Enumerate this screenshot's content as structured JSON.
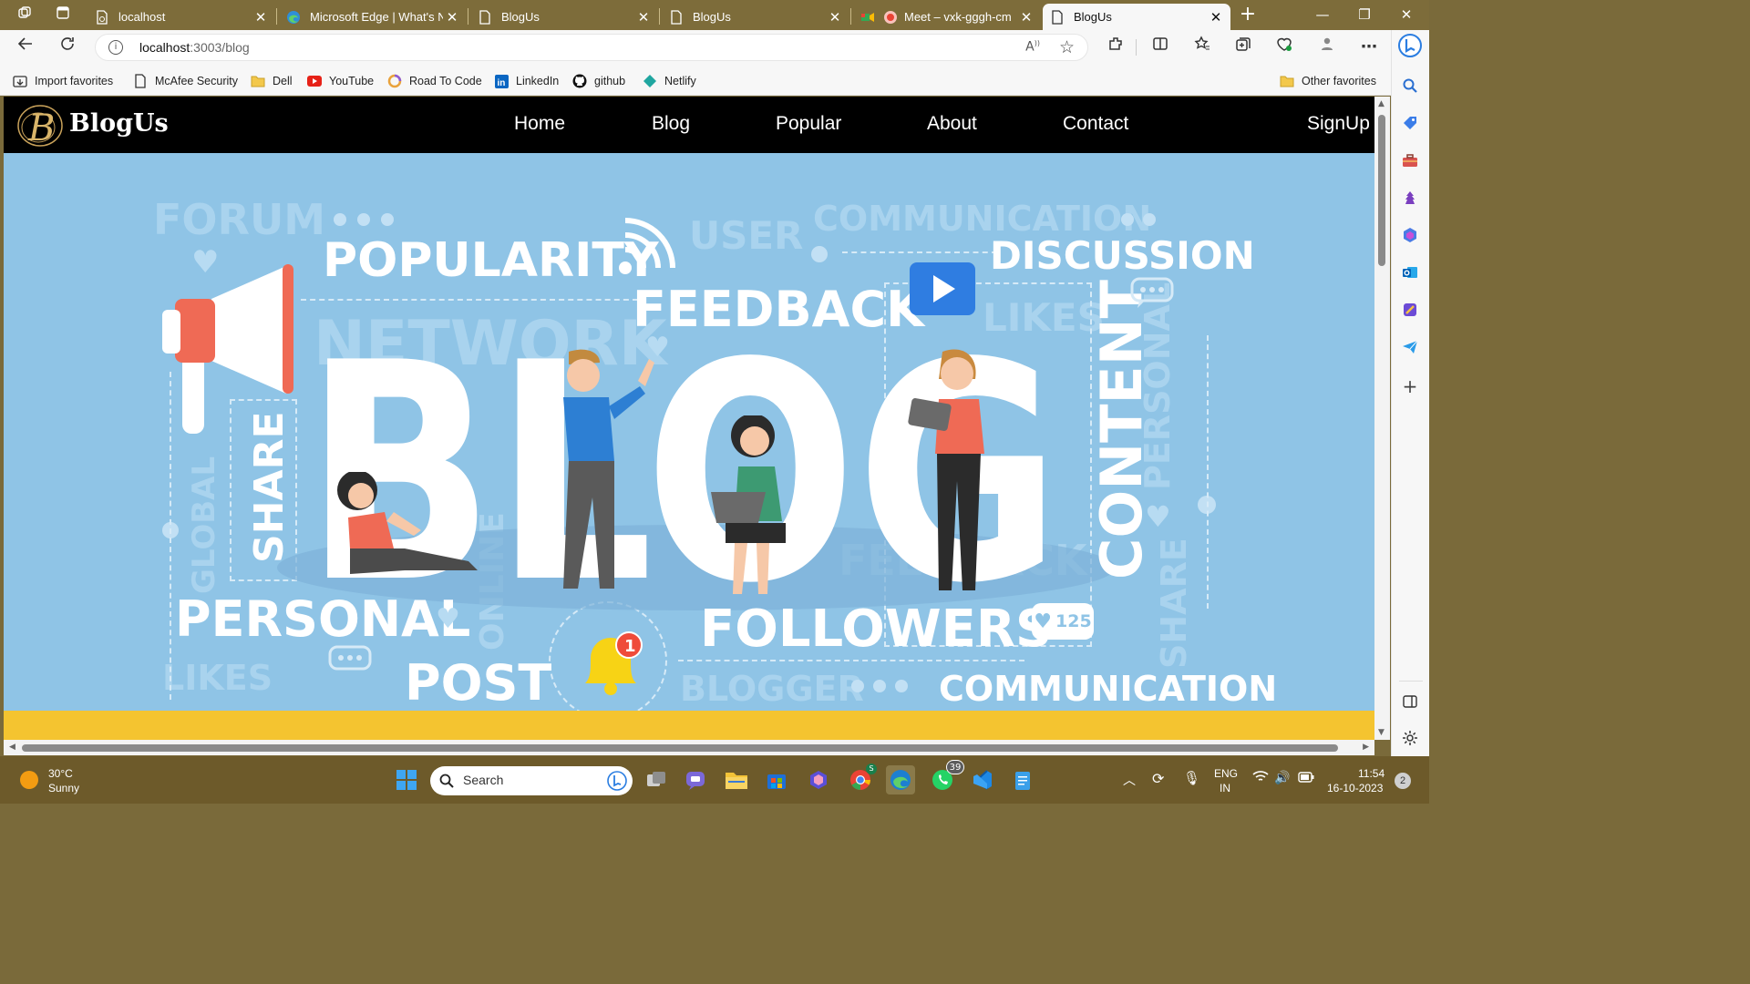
{
  "browser": {
    "tabs": [
      {
        "title": "localhost"
      },
      {
        "title": "Microsoft Edge | What's New"
      },
      {
        "title": "BlogUs"
      },
      {
        "title": "BlogUs"
      },
      {
        "title": "Meet – vxk-gggh-cm"
      },
      {
        "title": "BlogUs"
      }
    ],
    "url_host": "localhost",
    "url_path": ":3003/blog",
    "favorites": [
      {
        "label": "Import favorites",
        "icon": "import-icon"
      },
      {
        "label": "McAfee Security",
        "icon": "page-icon"
      },
      {
        "label": "Dell",
        "icon": "folder-icon"
      },
      {
        "label": "YouTube",
        "icon": "youtube-icon"
      },
      {
        "label": "Road To Code",
        "icon": "road-to-code-icon"
      },
      {
        "label": "LinkedIn",
        "icon": "linkedin-icon"
      },
      {
        "label": "github",
        "icon": "github-icon"
      },
      {
        "label": "Netlify",
        "icon": "netlify-icon"
      }
    ],
    "other_favorites": "Other favorites"
  },
  "site": {
    "logo_text": "BlogUs",
    "logo_letter": "B",
    "nav": [
      "Home",
      "Blog",
      "Popular",
      "About",
      "Contact"
    ],
    "signup": "SignUp"
  },
  "hero": {
    "big_word": "BLOG",
    "strong_words": {
      "popularity": "POPULARITY",
      "feedback": "FEEDBACK",
      "discussion": "DISCUSSION",
      "content": "CONTENT",
      "share": "SHARE",
      "personal": "PERSONAL",
      "post": "POST",
      "followers": "FOLLOWERS",
      "communication": "COMMUNICATION"
    },
    "faint_words": {
      "forum": "FORUM",
      "user": "USER",
      "communication": "COMMUNICATION",
      "network": "NETWORK",
      "likes_top": "LIKES",
      "personal_right": "PERSONAL",
      "global": "GLOBAL",
      "online": "ONLINE",
      "likes_bottom": "LIKES",
      "blogger": "BLOGGER",
      "share_right": "SHARE",
      "feedback": "FEEDBACK"
    },
    "likes_count": "125",
    "bell_badge": "1"
  },
  "taskbar": {
    "weather_temp": "30°C",
    "weather_desc": "Sunny",
    "search_placeholder": "Search",
    "whatsapp_badge": "39",
    "lang_top": "ENG",
    "lang_bottom": "IN",
    "time": "11:54",
    "date": "16-10-2023",
    "notif_count": "2"
  }
}
